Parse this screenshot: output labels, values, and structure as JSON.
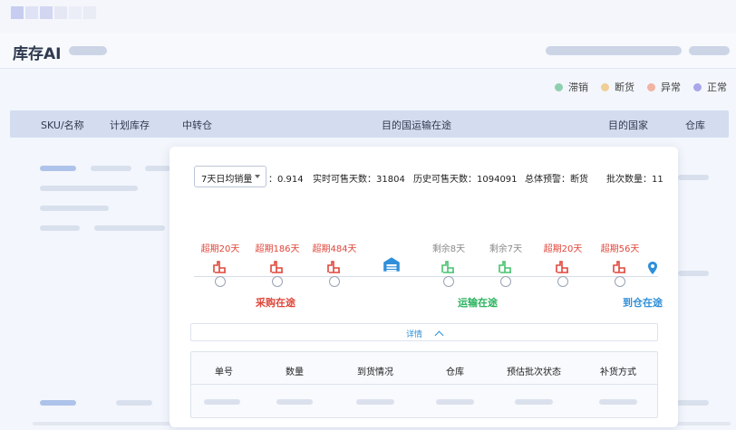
{
  "page": {
    "title": "库存AI"
  },
  "legend": [
    {
      "label": "滞销",
      "color": "#8fcfb0"
    },
    {
      "label": "断货",
      "color": "#efcf96"
    },
    {
      "label": "异常",
      "color": "#f1b3a2"
    },
    {
      "label": "正常",
      "color": "#a9a6ea"
    }
  ],
  "table": {
    "columns": [
      "SKU/名称",
      "计划库存",
      "中转仓",
      "目的国运输在途",
      "目的国家",
      "仓库"
    ]
  },
  "popup": {
    "sales_select": "7天日均销量",
    "sales_value": "：0.914",
    "stats": [
      "实时可售天数：31804",
      "历史可售天数：1094091",
      "总体预警：断货",
      "批次数量：11"
    ],
    "timeline": [
      {
        "label": "超期20天",
        "status": "overdue",
        "icon": "truck-red-icon"
      },
      {
        "label": "超期186天",
        "status": "overdue",
        "icon": "truck-red-icon"
      },
      {
        "label": "超期484天",
        "status": "overdue",
        "icon": "truck-red-icon"
      },
      {
        "label": "",
        "status": "warehouse",
        "icon": "warehouse-icon"
      },
      {
        "label": "剩余8天",
        "status": "remaining",
        "icon": "truck-green-icon"
      },
      {
        "label": "剩余7天",
        "status": "remaining",
        "icon": "truck-green-icon"
      },
      {
        "label": "超期20天",
        "status": "overdue",
        "icon": "truck-red-icon"
      },
      {
        "label": "超期56天",
        "status": "overdue",
        "icon": "truck-red-icon"
      }
    ],
    "stages": {
      "purchase": "采购在途",
      "transport": "运输在途",
      "arrival": "到仓在途"
    },
    "details_label": "详情",
    "detail_columns": [
      "单号",
      "数量",
      "到货情况",
      "仓库",
      "预估批次状态",
      "补货方式"
    ]
  },
  "colors": {
    "overdue": "#e0463a",
    "remaining": "#8a8a8a",
    "green": "#45c26e",
    "blue": "#2f8fd8",
    "purchase_stage": "#e0463a",
    "transport_stage": "#2bb35f",
    "arrival_stage": "#2f8fd8"
  }
}
